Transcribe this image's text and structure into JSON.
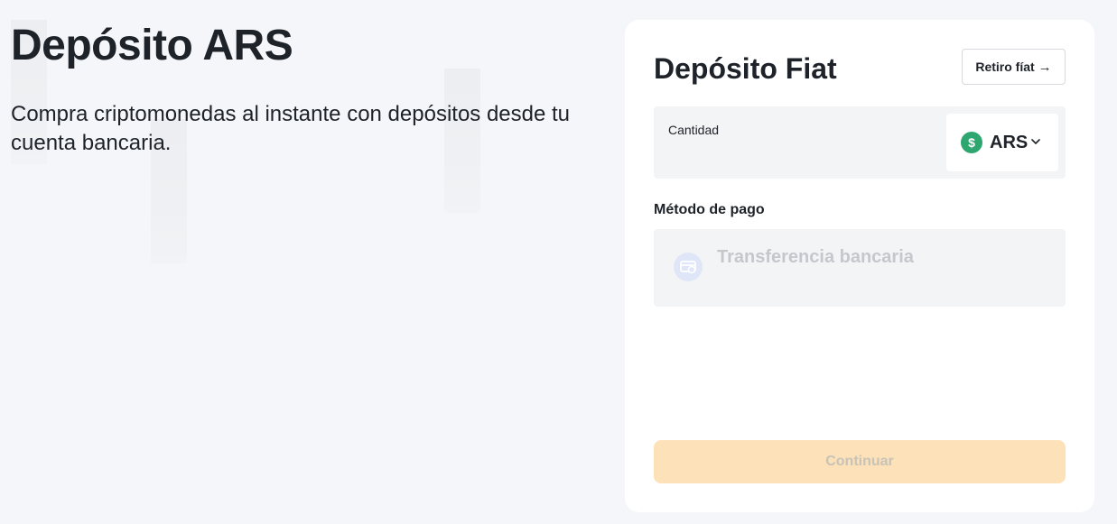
{
  "hero": {
    "title": "Depósito ARS",
    "subtitle": "Compra criptomonedas al instante con depósitos desde tu cuenta bancaria."
  },
  "card": {
    "title": "Depósito Fiat",
    "withdraw_label": "Retiro fíat",
    "withdraw_icon": "arrow-right-icon",
    "amount": {
      "label": "Cantidad",
      "value": "",
      "currency_code": "ARS",
      "currency_icon_glyph": "$",
      "currency_icon_color": "#2ea66f"
    },
    "payment_method": {
      "label": "Método de pago",
      "selected": "Transferencia bancaria",
      "icon": "bank-card-icon"
    },
    "continue_label": "Continuar"
  },
  "colors": {
    "background": "#f5f6fa",
    "card": "#ffffff",
    "field": "#f3f4f6",
    "continue_disabled": "#fde1b9"
  }
}
